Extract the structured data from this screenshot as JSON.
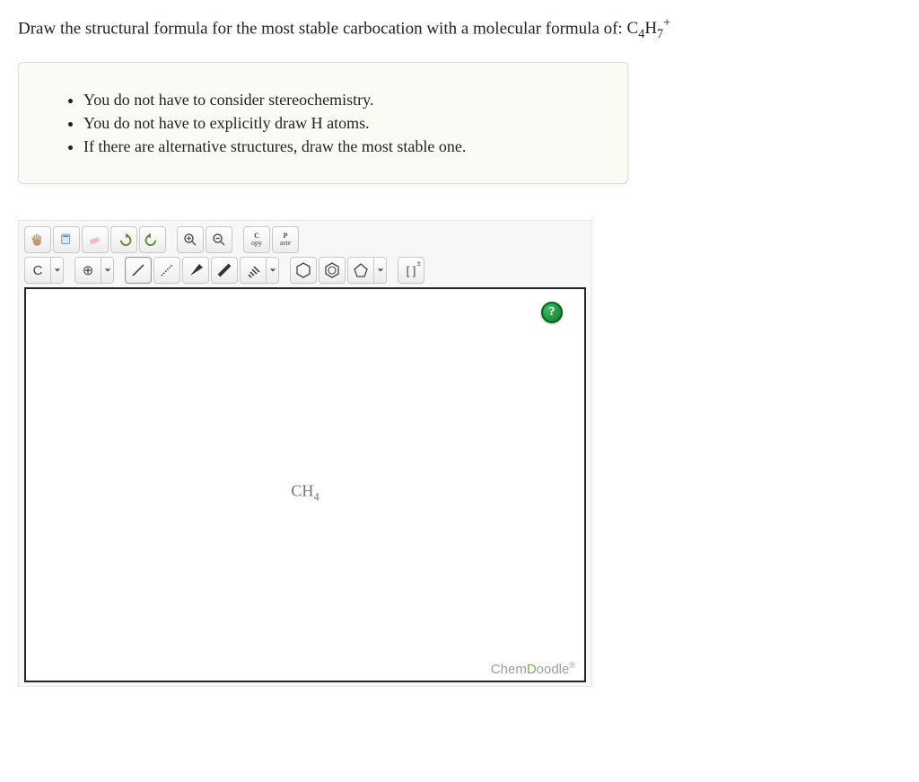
{
  "question": {
    "prefix": "Draw the structural formula for the most stable carbocation with a molecular formula of: ",
    "formula_base": "C",
    "formula_sub1": "4",
    "formula_mid": "H",
    "formula_sub2": "7",
    "formula_sup": "+"
  },
  "hints": [
    "You do not have to consider stereochemistry.",
    "You do not have to explicitly draw H atoms.",
    "If there are alternative structures, draw the most stable one."
  ],
  "toolbar": {
    "row1": {
      "hand": "hand-icon",
      "lasso": "lasso-icon",
      "eraser": "eraser-icon",
      "undo": "undo-icon",
      "redo": "redo-icon",
      "zoom_in": "zoom-in-icon",
      "zoom_out": "zoom-out-icon",
      "copy_top": "C",
      "copy_bottom": "opy",
      "paste_top": "P",
      "paste_bottom": "aste"
    },
    "row2": {
      "element": "C",
      "charge": "⊕",
      "bond_single": "single",
      "bond_recessed": "recessed",
      "bond_wedge": "wedge",
      "bond_bold": "bold",
      "bond_hash": "hash",
      "ring_hex": "hexagon",
      "ring_benz": "benzene",
      "ring_pent": "pentagon",
      "bracket": "[ ]",
      "bracket_sup": "±"
    }
  },
  "canvas": {
    "placeholder_base": "CH",
    "placeholder_sub": "4",
    "help": "?",
    "brand_prefix": "Chem",
    "brand_d": "D",
    "brand_suffix": "oodle",
    "brand_reg": "®"
  }
}
